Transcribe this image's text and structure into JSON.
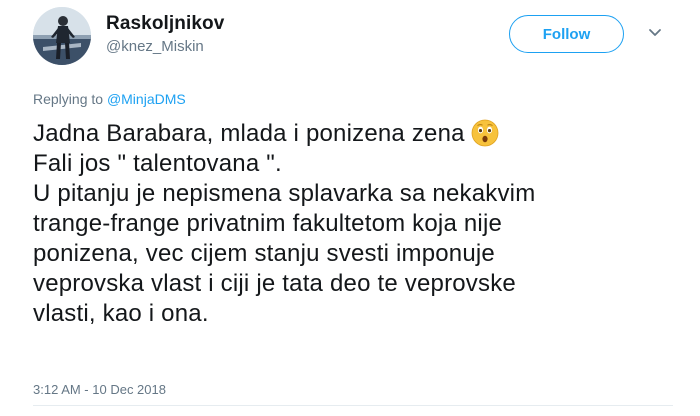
{
  "author": {
    "display_name": "Raskoljnikov",
    "handle": "@knez_Miskin",
    "avatar": "profile-photo"
  },
  "follow_button": {
    "label": "Follow"
  },
  "menu": {
    "icon": "chevron-down-icon"
  },
  "reply": {
    "prefix": "Replying to",
    "mention": "@MinjaDMS"
  },
  "tweet": {
    "lines": [
      "Jadna Barabara, mlada i ponizena zena",
      "Fali jos \" talentovana \".",
      "U pitanju je nepismena splavarka sa nekakvim",
      "trange-frange privatnim fakultetom koja nije",
      "ponizena, vec cijem stanju svesti imponuje",
      "veprovska vlast i ciji je tata deo te veprovske",
      "vlasti, kao i ona."
    ],
    "emoji": "hushed-face-emoji"
  },
  "timestamp": "3:12 AM - 10 Dec 2018",
  "colors": {
    "accent": "#1da1f2",
    "secondary_text": "#657786",
    "primary_text": "#14171a"
  }
}
